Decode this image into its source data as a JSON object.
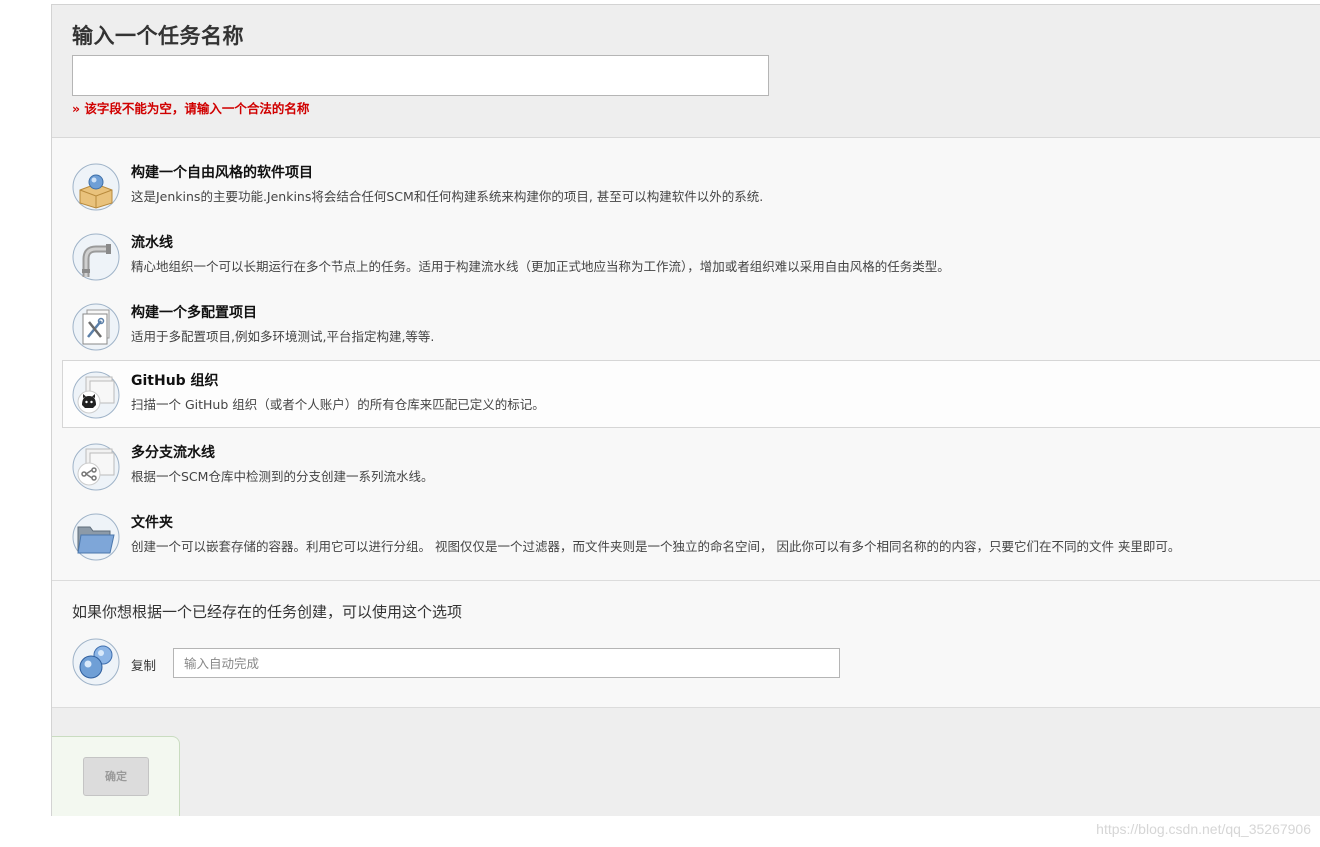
{
  "header": {
    "title": "输入一个任务名称",
    "name_input_value": "",
    "error": "» 该字段不能为空，请输入一个合法的名称"
  },
  "items": [
    {
      "title": "构建一个自由风格的软件项目",
      "desc": "这是Jenkins的主要功能.Jenkins将会结合任何SCM和任何构建系统来构建你的项目, 甚至可以构建软件以外的系统.",
      "icon": "package-icon"
    },
    {
      "title": "流水线",
      "desc": "精心地组织一个可以长期运行在多个节点上的任务。适用于构建流水线（更加正式地应当称为工作流），增加或者组织难以采用自由风格的任务类型。",
      "icon": "pipe-icon"
    },
    {
      "title": "构建一个多配置项目",
      "desc": "适用于多配置项目,例如多环境测试,平台指定构建,等等.",
      "icon": "config-tools-icon"
    },
    {
      "title": "GitHub 组织",
      "desc": "扫描一个 GitHub 组织（或者个人账户）的所有仓库来匹配已定义的标记。",
      "icon": "github-icon"
    },
    {
      "title": "多分支流水线",
      "desc": "根据一个SCM仓库中检测到的分支创建一系列流水线。",
      "icon": "branch-icon"
    },
    {
      "title": "文件夹",
      "desc": "创建一个可以嵌套存储的容器。利用它可以进行分组。 视图仅仅是一个过滤器，而文件夹则是一个独立的命名空间， 因此你可以有多个相同名称的的内容，只要它们在不同的文件 夹里即可。",
      "icon": "folder-icon"
    }
  ],
  "copy": {
    "title": "如果你想根据一个已经存在的任务创建，可以使用这个选项",
    "label": "复制",
    "placeholder": "输入自动完成",
    "icon": "copy-bubbles-icon"
  },
  "footer": {
    "ok_label": "确定"
  },
  "watermark": "https://blog.csdn.net/qq_35267906"
}
